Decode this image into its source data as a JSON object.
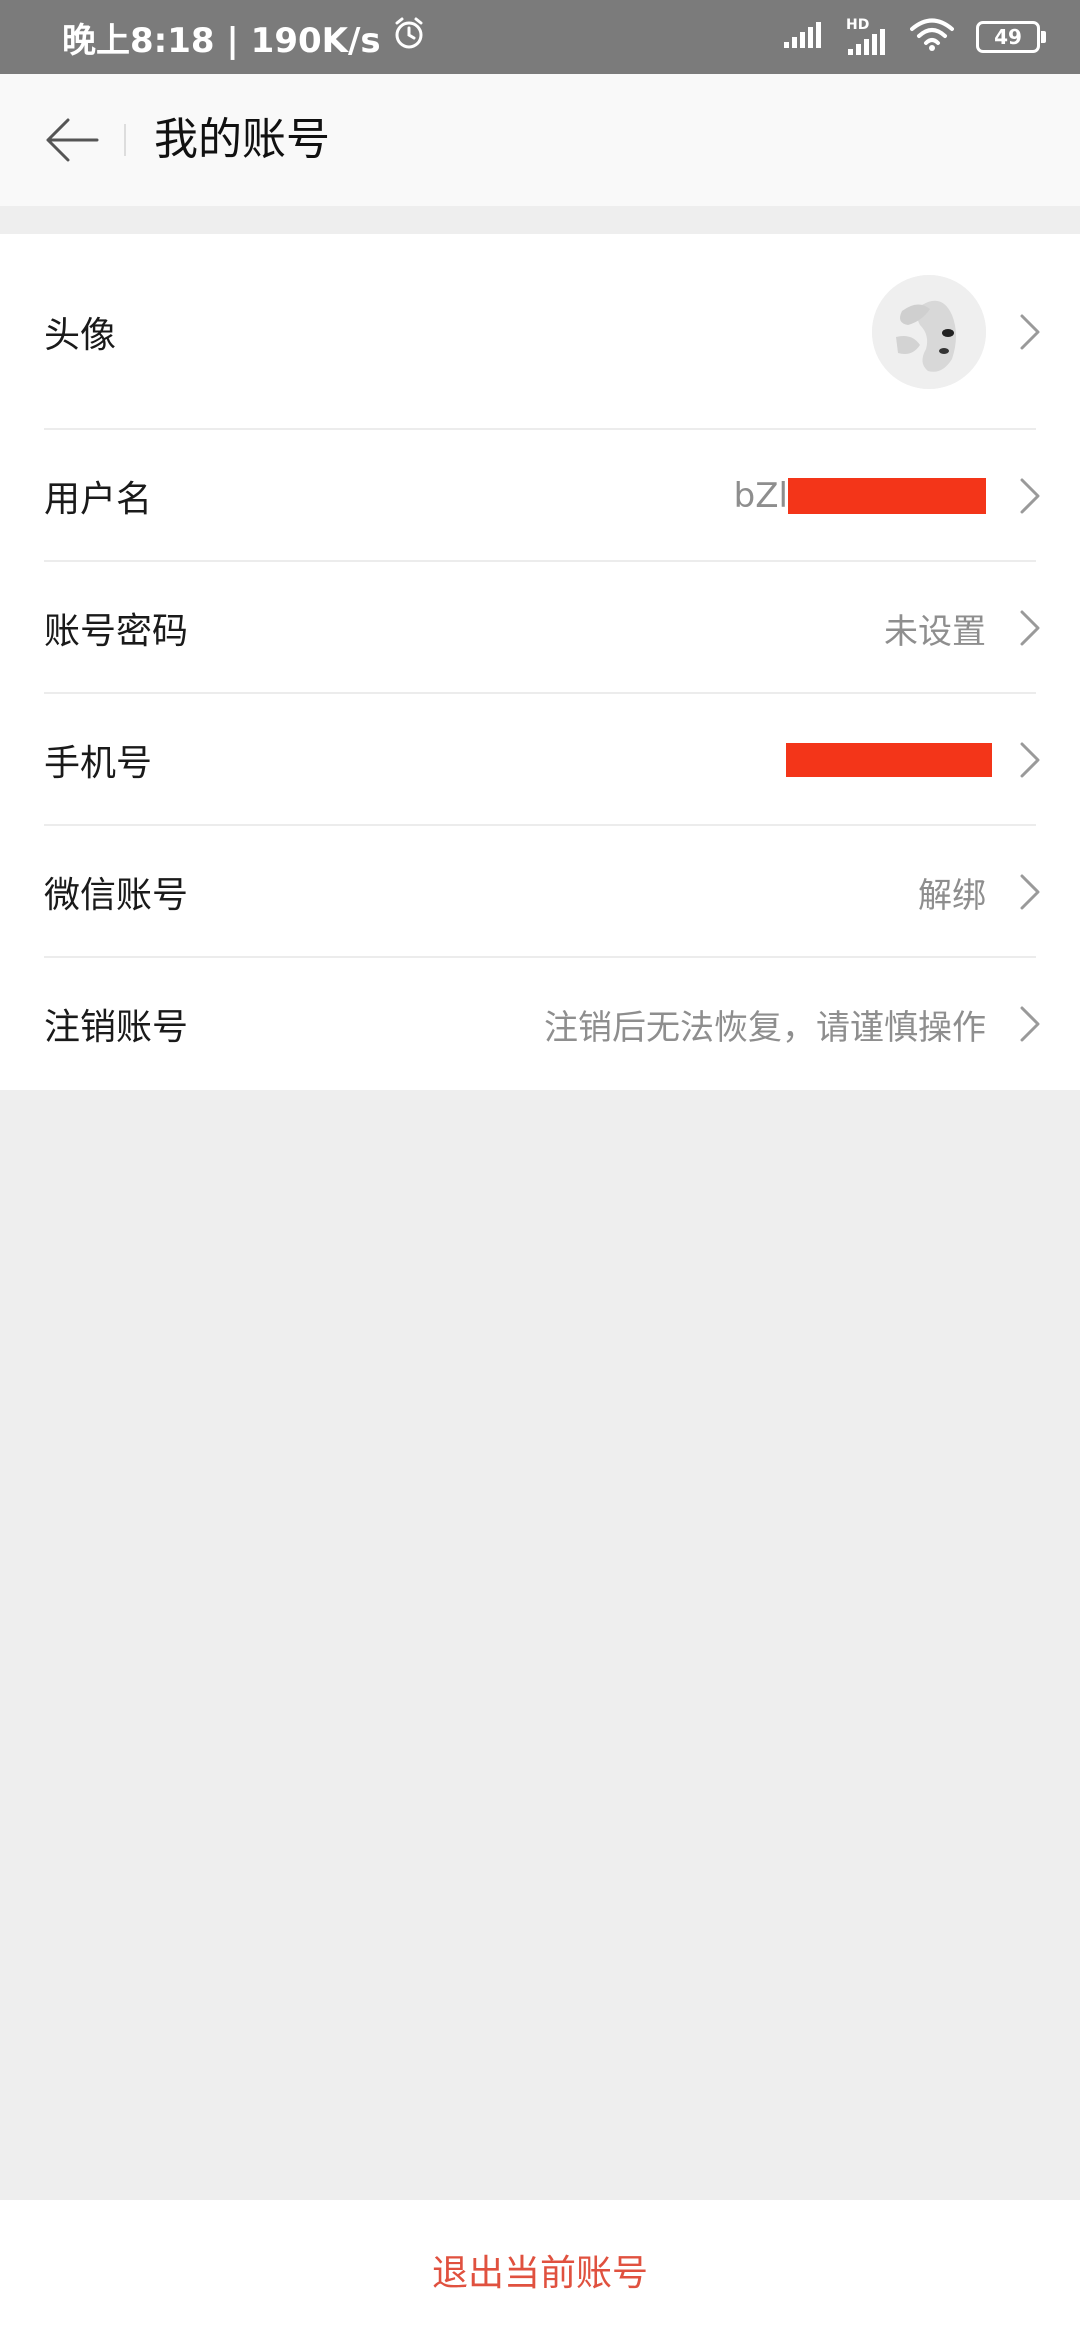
{
  "status_bar": {
    "time": "晚上8:18 | 190K/s",
    "battery": "49",
    "hd_label": "HD"
  },
  "header": {
    "title": "我的账号"
  },
  "rows": [
    {
      "label": "头像",
      "value": ""
    },
    {
      "label": "用户名",
      "value": "bZl"
    },
    {
      "label": "账号密码",
      "value": "未设置"
    },
    {
      "label": "手机号",
      "value": ""
    },
    {
      "label": "微信账号",
      "value": "解绑"
    },
    {
      "label": "注销账号",
      "value": "注销后无法恢复，请谨慎操作"
    }
  ],
  "footer": {
    "logout_label": "退出当前账号"
  },
  "colors": {
    "accent_red": "#e0513f",
    "redaction": "#f33519"
  }
}
